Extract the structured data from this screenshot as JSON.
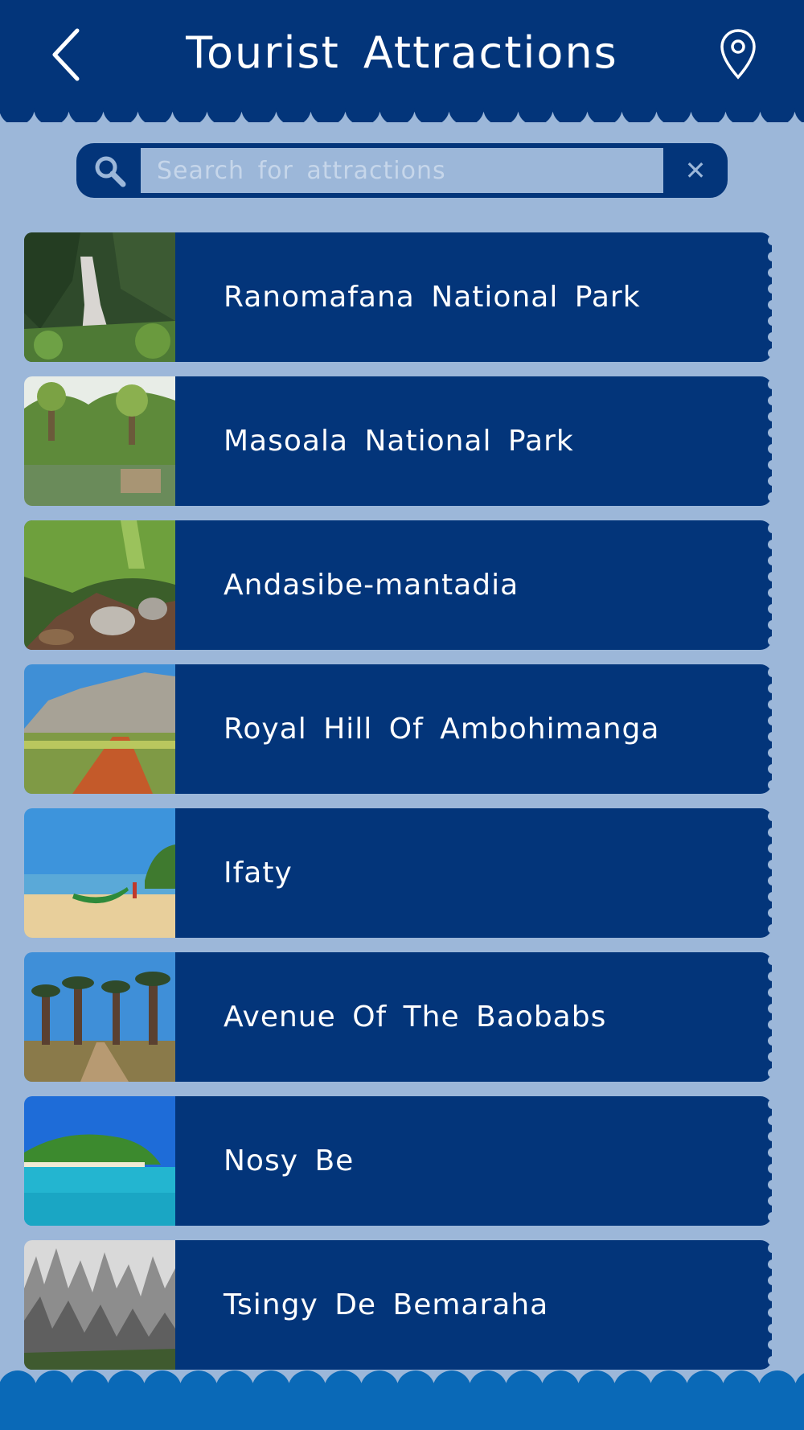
{
  "header": {
    "title": "Tourist Attractions",
    "back_icon": "chevron-left-icon",
    "location_icon": "map-pin-icon"
  },
  "search": {
    "placeholder": "Search for attractions",
    "value": "",
    "search_icon": "magnifier-icon",
    "clear_label": "✕"
  },
  "attractions": [
    {
      "name": "Ranomafana National Park",
      "thumb": "waterfall-forest"
    },
    {
      "name": "Masoala National Park",
      "thumb": "rainforest-village"
    },
    {
      "name": "Andasibe-mantadia",
      "thumb": "jungle-stream"
    },
    {
      "name": "Royal Hill Of Ambohimanga",
      "thumb": "mountain-road"
    },
    {
      "name": "Ifaty",
      "thumb": "beach-boat"
    },
    {
      "name": "Avenue Of The Baobabs",
      "thumb": "baobab-road"
    },
    {
      "name": "Nosy Be",
      "thumb": "tropical-island"
    },
    {
      "name": "Tsingy De Bemaraha",
      "thumb": "limestone-pinnacles"
    }
  ],
  "colors": {
    "background": "#9cb7d9",
    "primary": "#03357a",
    "footer": "#0a69b7",
    "text": "#ffffff"
  }
}
